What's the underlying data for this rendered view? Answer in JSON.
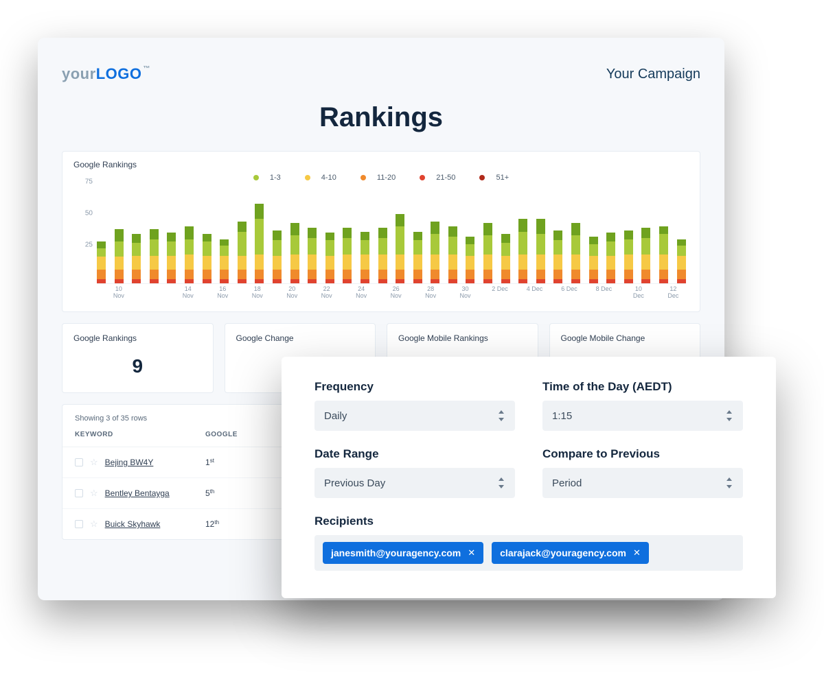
{
  "header": {
    "logo_your": "your",
    "logo_logo": "LOGO",
    "logo_tm": "™",
    "campaign": "Your Campaign"
  },
  "page_title": "Rankings",
  "chart_title": "Google Rankings",
  "legend": {
    "r1": "1-3",
    "r2": "4-10",
    "r3": "11-20",
    "r4": "21-50",
    "r5": "51+"
  },
  "colors": {
    "r1": "#6fa21f",
    "r2": "#a8c93a",
    "r3": "#f6c945",
    "r4": "#f08a2c",
    "r5": "#e0432f"
  },
  "stats": {
    "s1_title": "Google Rankings",
    "s1_value": "9",
    "s2_title": "Google Change",
    "s3_title": "Google Mobile Rankings",
    "s4_title": "Google Mobile Change"
  },
  "table": {
    "meta": "Showing 3 of 35 rows",
    "col_keyword": "KEYWORD",
    "col_google": "GOOGLE",
    "rows": [
      {
        "keyword": "Bejing BW4Y",
        "rank": "1",
        "suffix": "st"
      },
      {
        "keyword": "Bentley Bentayga",
        "rank": "5",
        "suffix": "th"
      },
      {
        "keyword": "Buick Skyhawk",
        "rank": "12",
        "suffix": "th"
      }
    ]
  },
  "modal": {
    "frequency_label": "Frequency",
    "frequency_value": "Daily",
    "time_label": "Time of the Day (AEDT)",
    "time_value": "1:15",
    "date_range_label": "Date Range",
    "date_range_value": "Previous Day",
    "compare_label": "Compare to Previous",
    "compare_value": "Period",
    "recipients_label": "Recipients",
    "recipients": [
      "janesmith@youragency.com",
      "clarajack@youragency.com"
    ]
  },
  "chart_data": {
    "type": "bar",
    "title": "Google Rankings",
    "ylabel": "",
    "xlabel": "",
    "ylim": [
      0,
      75
    ],
    "y_ticks": [
      25,
      50,
      75
    ],
    "categories": [
      "9 Nov",
      "10 Nov",
      "11 Nov",
      "12 Nov",
      "13 Nov",
      "14 Nov",
      "15 Nov",
      "16 Nov",
      "17 Nov",
      "18 Nov",
      "19 Nov",
      "20 Nov",
      "21 Nov",
      "22 Nov",
      "23 Nov",
      "24 Nov",
      "25 Nov",
      "26 Nov",
      "27 Nov",
      "28 Nov",
      "29 Nov",
      "30 Nov",
      "1 Dec",
      "2 Dec",
      "3 Dec",
      "4 Dec",
      "5 Dec",
      "6 Dec",
      "7 Dec",
      "8 Dec",
      "9 Dec",
      "10 Dec",
      "11 Dec",
      "12 Dec"
    ],
    "x_tick_labels": [
      "10 Nov",
      "14 Nov",
      "16 Nov",
      "18 Nov",
      "20 Nov",
      "22 Nov",
      "24 Nov",
      "26 Nov",
      "28 Nov",
      "30 Nov",
      "2 Dec",
      "4 Dec",
      "6 Dec",
      "8 Dec",
      "10 Dec",
      "12 Dec"
    ],
    "series": [
      {
        "name": "51+",
        "color": "#e0432f",
        "values": [
          3,
          3,
          3,
          3,
          3,
          3,
          3,
          3,
          3,
          3,
          3,
          3,
          3,
          3,
          3,
          3,
          3,
          3,
          3,
          3,
          3,
          3,
          3,
          3,
          3,
          3,
          3,
          3,
          3,
          3,
          3,
          3,
          3,
          3
        ]
      },
      {
        "name": "21-50",
        "color": "#f08a2c",
        "values": [
          8,
          8,
          8,
          8,
          8,
          8,
          8,
          8,
          8,
          8,
          8,
          8,
          8,
          8,
          8,
          8,
          8,
          8,
          8,
          8,
          8,
          8,
          8,
          8,
          8,
          8,
          8,
          8,
          8,
          8,
          8,
          8,
          8,
          8
        ]
      },
      {
        "name": "11-20",
        "color": "#f6c945",
        "values": [
          10,
          10,
          11,
          11,
          11,
          12,
          11,
          11,
          11,
          12,
          11,
          12,
          12,
          11,
          12,
          12,
          12,
          12,
          12,
          12,
          12,
          11,
          12,
          11,
          12,
          12,
          12,
          12,
          11,
          11,
          12,
          12,
          12,
          11
        ]
      },
      {
        "name": "4-10",
        "color": "#a8c93a",
        "values": [
          7,
          12,
          10,
          13,
          11,
          12,
          11,
          8,
          19,
          28,
          12,
          15,
          13,
          12,
          13,
          11,
          13,
          22,
          11,
          16,
          14,
          9,
          15,
          10,
          18,
          16,
          11,
          15,
          9,
          11,
          12,
          13,
          16,
          8
        ]
      },
      {
        "name": "1-3",
        "color": "#6fa21f",
        "values": [
          5,
          10,
          7,
          8,
          7,
          10,
          6,
          5,
          8,
          12,
          8,
          10,
          8,
          6,
          8,
          7,
          8,
          10,
          7,
          10,
          8,
          6,
          10,
          7,
          10,
          12,
          8,
          10,
          6,
          7,
          7,
          8,
          6,
          5
        ]
      }
    ]
  }
}
